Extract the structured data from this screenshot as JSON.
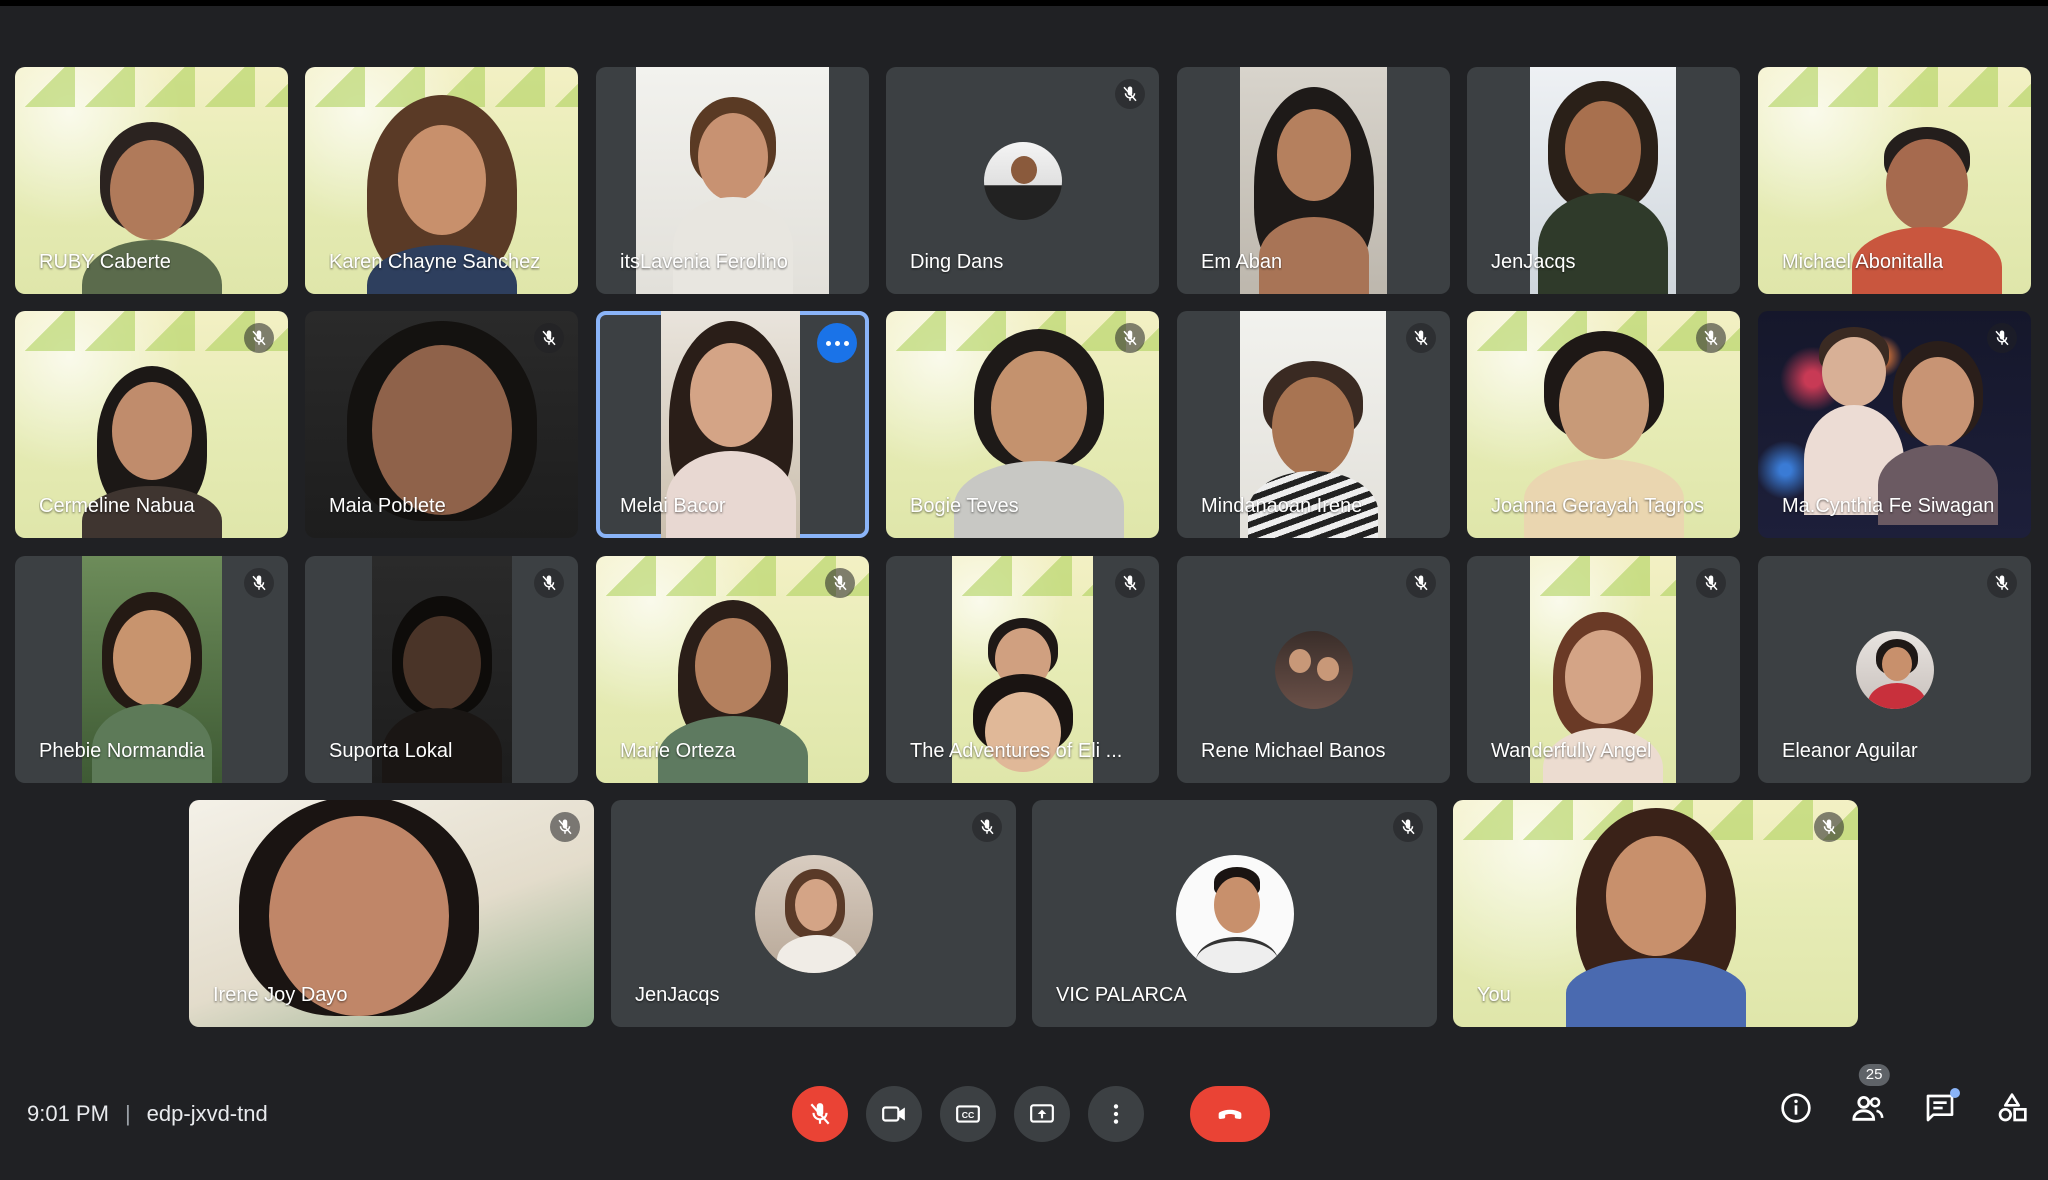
{
  "meeting": {
    "time": "9:01 PM",
    "separator": "|",
    "code": "edp-jxvd-tnd",
    "participants_count": "25",
    "chat_has_unread": true
  },
  "colors": {
    "background": "#202124",
    "tile": "#3c4043",
    "accent_blue": "#8ab4f8",
    "red": "#ea4335"
  },
  "participants": [
    {
      "name": "RUBY Caberte",
      "muted": false,
      "video": "banner"
    },
    {
      "name": "Karen Chayne Sanchez",
      "muted": false,
      "video": "banner"
    },
    {
      "name": "itsLavenia Ferolino",
      "muted": false,
      "video": "light"
    },
    {
      "name": "Ding Dans",
      "muted": true,
      "video": "avatar"
    },
    {
      "name": "Em Aban",
      "muted": false,
      "video": "dark"
    },
    {
      "name": "JenJacqs",
      "muted": false,
      "video": "light"
    },
    {
      "name": "Michael Abonitalla",
      "muted": false,
      "video": "banner"
    },
    {
      "name": "Cermeline Nabua",
      "muted": true,
      "video": "banner"
    },
    {
      "name": "Maia Poblete",
      "muted": true,
      "video": "dark"
    },
    {
      "name": "Melai Bacor",
      "muted": false,
      "video": "light",
      "pinned": true
    },
    {
      "name": "Bogie Teves",
      "muted": true,
      "video": "banner"
    },
    {
      "name": "Mindanaoan Irene",
      "muted": true,
      "video": "light"
    },
    {
      "name": "Joanna Gerayah Tagros",
      "muted": true,
      "video": "banner"
    },
    {
      "name": "Ma.Cynthia Fe Siwagan",
      "muted": true,
      "video": "fireworks"
    },
    {
      "name": "Phebie Normandia",
      "muted": true,
      "video": "light"
    },
    {
      "name": "Suporta Lokal",
      "muted": true,
      "video": "dark"
    },
    {
      "name": "Marie Orteza",
      "muted": true,
      "video": "banner"
    },
    {
      "name": "The Adventures of Eli ...",
      "muted": true,
      "video": "banner"
    },
    {
      "name": "Rene Michael Banos",
      "muted": true,
      "video": "avatar"
    },
    {
      "name": "Wanderfully Angel",
      "muted": true,
      "video": "banner"
    },
    {
      "name": "Eleanor Aguilar",
      "muted": true,
      "video": "avatar"
    },
    {
      "name": "Irene Joy Dayo",
      "muted": true,
      "video": "plant"
    },
    {
      "name": "JenJacqs",
      "muted": true,
      "video": "avatar"
    },
    {
      "name": "VIC PALARCA",
      "muted": true,
      "video": "avatar"
    },
    {
      "name": "You",
      "muted": true,
      "video": "banner"
    }
  ],
  "controls": {
    "mic": "microphone-off-icon",
    "camera": "camera-icon",
    "captions": "closed-captions-icon",
    "present": "present-screen-icon",
    "more": "more-options-icon",
    "leave": "hang-up-icon",
    "info": "info-icon",
    "people": "people-icon",
    "chat": "chat-icon",
    "activities": "activities-icon"
  }
}
